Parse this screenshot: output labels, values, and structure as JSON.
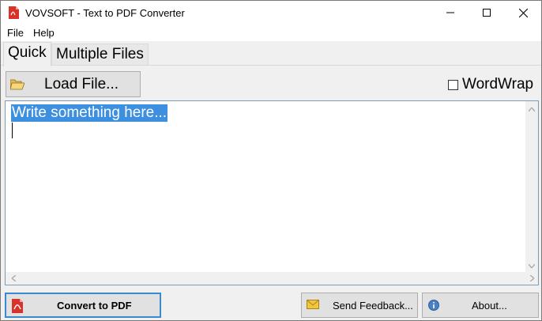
{
  "window": {
    "title": "VOVSOFT - Text to PDF Converter",
    "icon": "pdf-app-icon",
    "controls": [
      "minimize-icon",
      "maximize-icon",
      "close-icon"
    ]
  },
  "menu": {
    "file": "File",
    "help": "Help"
  },
  "tabs": {
    "quick": "Quick",
    "multiple": "Multiple Files",
    "active": "Quick"
  },
  "toolbar": {
    "load_label": "Load File...",
    "load_icon": "folder-open-icon",
    "wordwrap_label": "WordWrap",
    "wordwrap_checked": false
  },
  "editor": {
    "text": "Write something here..."
  },
  "footer": {
    "convert_label": "Convert to PDF",
    "convert_icon": "pdf-icon",
    "feedback_label": "Send Feedback...",
    "feedback_icon": "envelope-icon",
    "about_label": "About...",
    "about_icon": "info-icon"
  },
  "colors": {
    "accent": "#3d8fe0",
    "convert_border": "#3a8ad0",
    "pdf_red": "#d9322a"
  }
}
